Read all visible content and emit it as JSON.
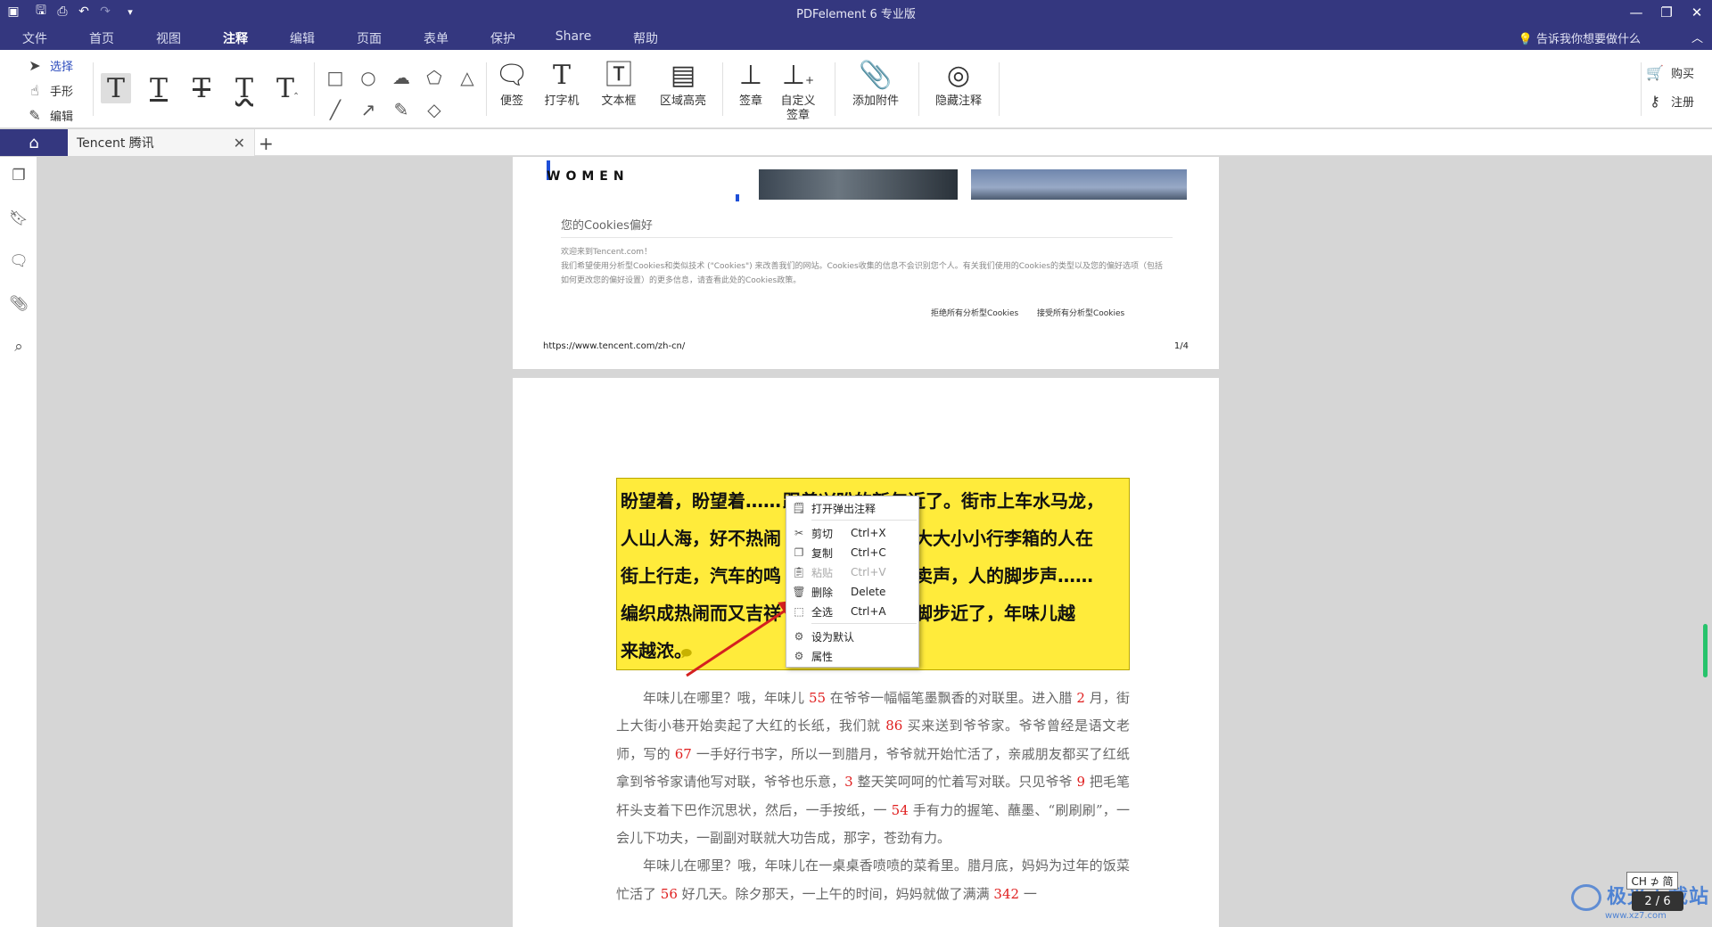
{
  "app": {
    "title": "PDFelement  6 专业版",
    "tellme": "告诉我你想要做什么"
  },
  "menus": [
    "文件",
    "首页",
    "视图",
    "注释",
    "编辑",
    "页面",
    "表单",
    "保护",
    "Share",
    "帮助"
  ],
  "active_menu": "注释",
  "modes": [
    "选择",
    "手形",
    "编辑"
  ],
  "ribbon": {
    "sticky": "便签",
    "typewriter": "打字机",
    "textbox": "文本框",
    "area_highlight": "区域高亮",
    "stamp": "签章",
    "custom_stamp": "自定义签章",
    "attach": "添加附件",
    "hide_annot": "隐藏注释",
    "buy": "购买",
    "register": "注册"
  },
  "tab": {
    "label": "Tencent 腾讯"
  },
  "page1": {
    "brand": "WOMEN",
    "cookie_title": "您的Cookies偏好",
    "cookie_line1": "欢迎来到Tencent.com！",
    "cookie_line2": "我们希望使用分析型Cookies和类似技术 (\"Cookies\") 来改善我们的网站。Cookies收集的信息不会识别您个人。有关我们使用的Cookies的类型以及您的偏好选项（包括",
    "cookie_line3": "如何更改您的偏好设置）的更多信息，请查看此处的Cookies政策。",
    "reject": "拒绝所有分析型Cookies",
    "accept": "接受所有分析型Cookies",
    "url": "https://www.tencent.com/zh-cn/",
    "page_num": "1/4"
  },
  "page2": {
    "highlight_lines": [
      "盼望着，盼望着……",
      "跟着兴盼的新年近了。街市上车水马龙，",
      "人山人海，好不热闹",
      "大大小小行李箱的人在",
      "街上行走，汽车的鸣",
      "卖声，人的脚步声……",
      "编织成热闹而又吉祥",
      "的脚步近了，年味儿越",
      "来越浓。"
    ],
    "p1": [
      "年味儿在哪里？哦，年味儿 ",
      "55",
      " 在爷爷一幅幅笔墨飘香的对联里。进入腊 ",
      "2",
      " 月，街上大街小巷开始卖起了大红的长纸，我们就 ",
      "86",
      " 买来送到爷爷家。爷爷曾经是语文老师，写的 ",
      "67",
      " 一手好行书字，所以一到腊月，爷爷就开始忙活了，亲戚朋友都买了红纸拿到爷爷家请他写对联，爷爷也乐意，",
      "3",
      " 整天笑呵呵的忙着写对联。只见爷爷 ",
      "9",
      " 把毛笔杆头支着下巴作沉思状，然后，一手按纸，一 ",
      "54",
      " 手有力的握笔、蘸墨、“刷刷刷”，一会儿下功夫，一副副对联就大功告成，那字，苍劲有力。"
    ],
    "p2": [
      "年味儿在哪里？哦，年味儿在一桌桌香喷喷的菜肴里。腊月底，妈妈为过年的饭菜忙活了 ",
      "56",
      " 好几天。除夕那天，一上午的时间，妈妈就做了满满 ",
      "342",
      " 一"
    ]
  },
  "context_menu": [
    {
      "label": "打开弹出注释",
      "shortcut": "",
      "icon": "note-icon",
      "enabled": true
    },
    {
      "label": "剪切",
      "shortcut": "Ctrl+X",
      "icon": "scissors-icon",
      "enabled": true
    },
    {
      "label": "复制",
      "shortcut": "Ctrl+C",
      "icon": "copy-icon",
      "enabled": true
    },
    {
      "label": "粘贴",
      "shortcut": "Ctrl+V",
      "icon": "paste-icon",
      "enabled": false
    },
    {
      "label": "删除",
      "shortcut": "Delete",
      "icon": "trash-icon",
      "enabled": true
    },
    {
      "label": "全选",
      "shortcut": "Ctrl+A",
      "icon": "select-all-icon",
      "enabled": true
    },
    {
      "label": "设为默认",
      "shortcut": "",
      "icon": "gear-icon",
      "enabled": true
    },
    {
      "label": "属性",
      "shortcut": "",
      "icon": "gear-icon",
      "enabled": true
    }
  ],
  "status": {
    "ime": "CH ⊅ 简",
    "page_indicator": "2 / 6",
    "watermark": "极光下载站",
    "watermark_url": "www.xz7.com"
  },
  "colors": {
    "titlebar": "#34377f",
    "highlight": "#ffeb3b",
    "number_red": "#e02020"
  }
}
